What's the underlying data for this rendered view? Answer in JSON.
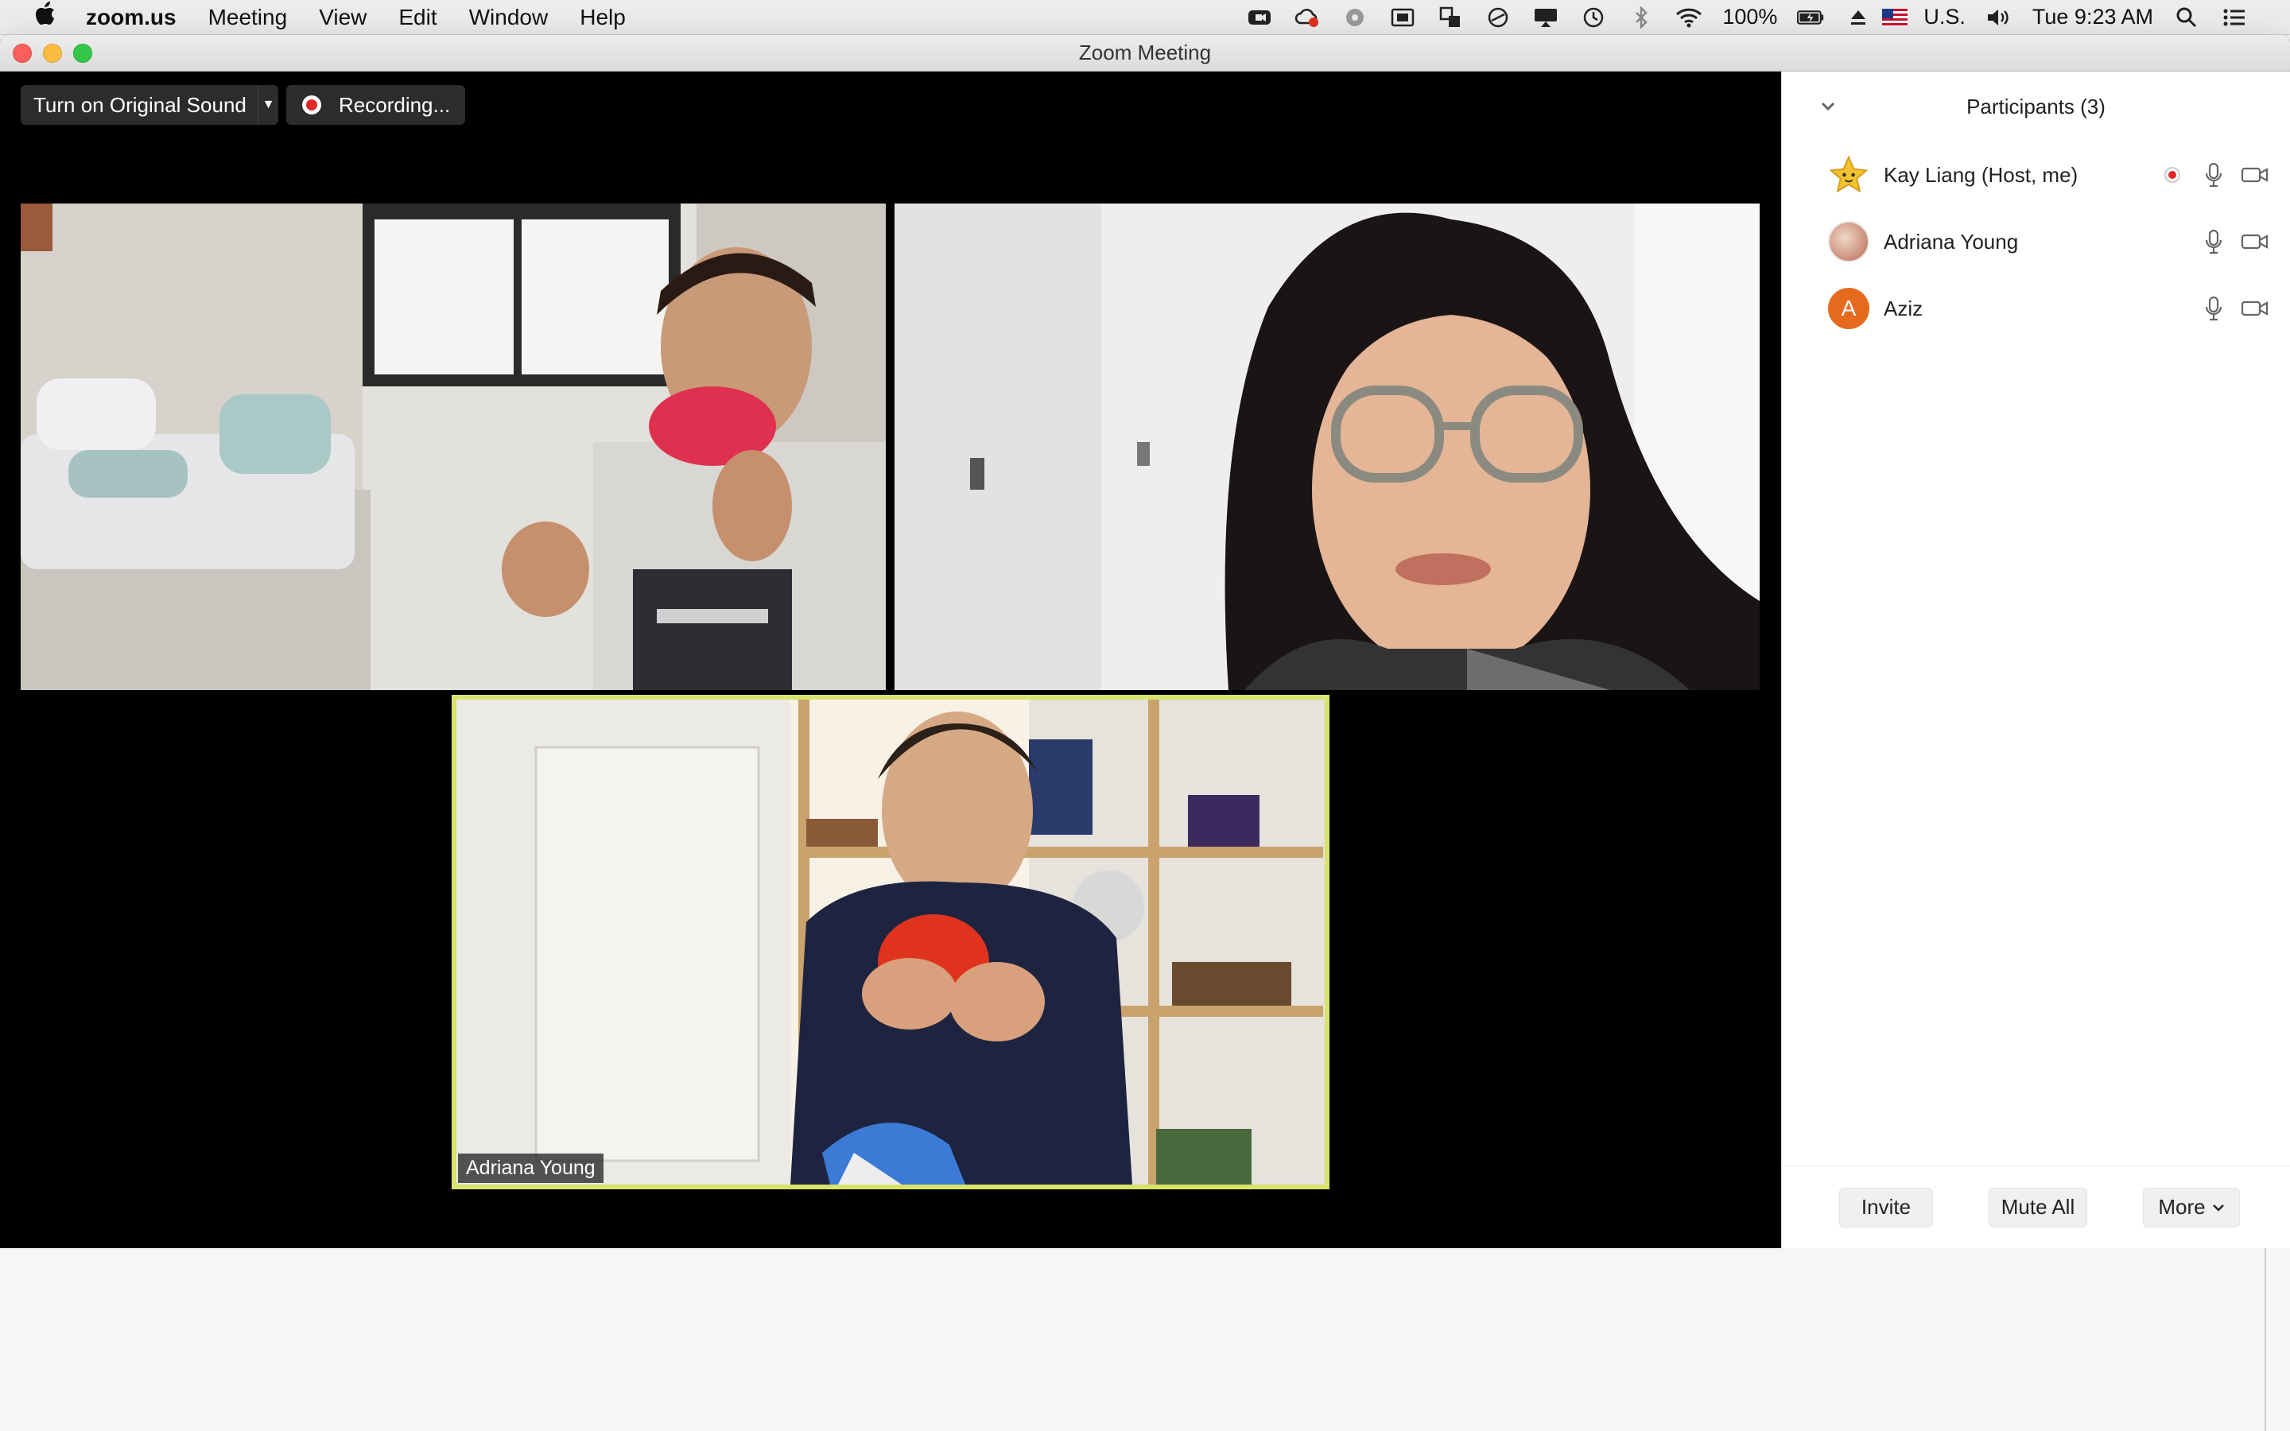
{
  "menubar": {
    "app_name": "zoom.us",
    "menus": [
      "Meeting",
      "View",
      "Edit",
      "Window",
      "Help"
    ],
    "battery": "100%",
    "input_source": "U.S.",
    "clock": "Tue 9:23 AM"
  },
  "window": {
    "title": "Zoom Meeting"
  },
  "toolbar": {
    "original_sound_label": "Turn on Original Sound",
    "recording_label": "Recording..."
  },
  "videos": {
    "active_speaker_name": "Adriana Young",
    "highlight_color": "#d7e36b"
  },
  "participants_panel": {
    "title": "Participants (3)",
    "participants": [
      {
        "name": "Kay Liang (Host, me)",
        "avatar": "star",
        "recording": true
      },
      {
        "name": "Adriana Young",
        "avatar": "photo",
        "recording": false
      },
      {
        "name": "Aziz",
        "avatar": "letter",
        "avatar_letter": "A",
        "avatar_color": "#e66a1e",
        "recording": false
      }
    ],
    "invite_label": "Invite",
    "mute_all_label": "Mute All",
    "more_label": "More"
  }
}
